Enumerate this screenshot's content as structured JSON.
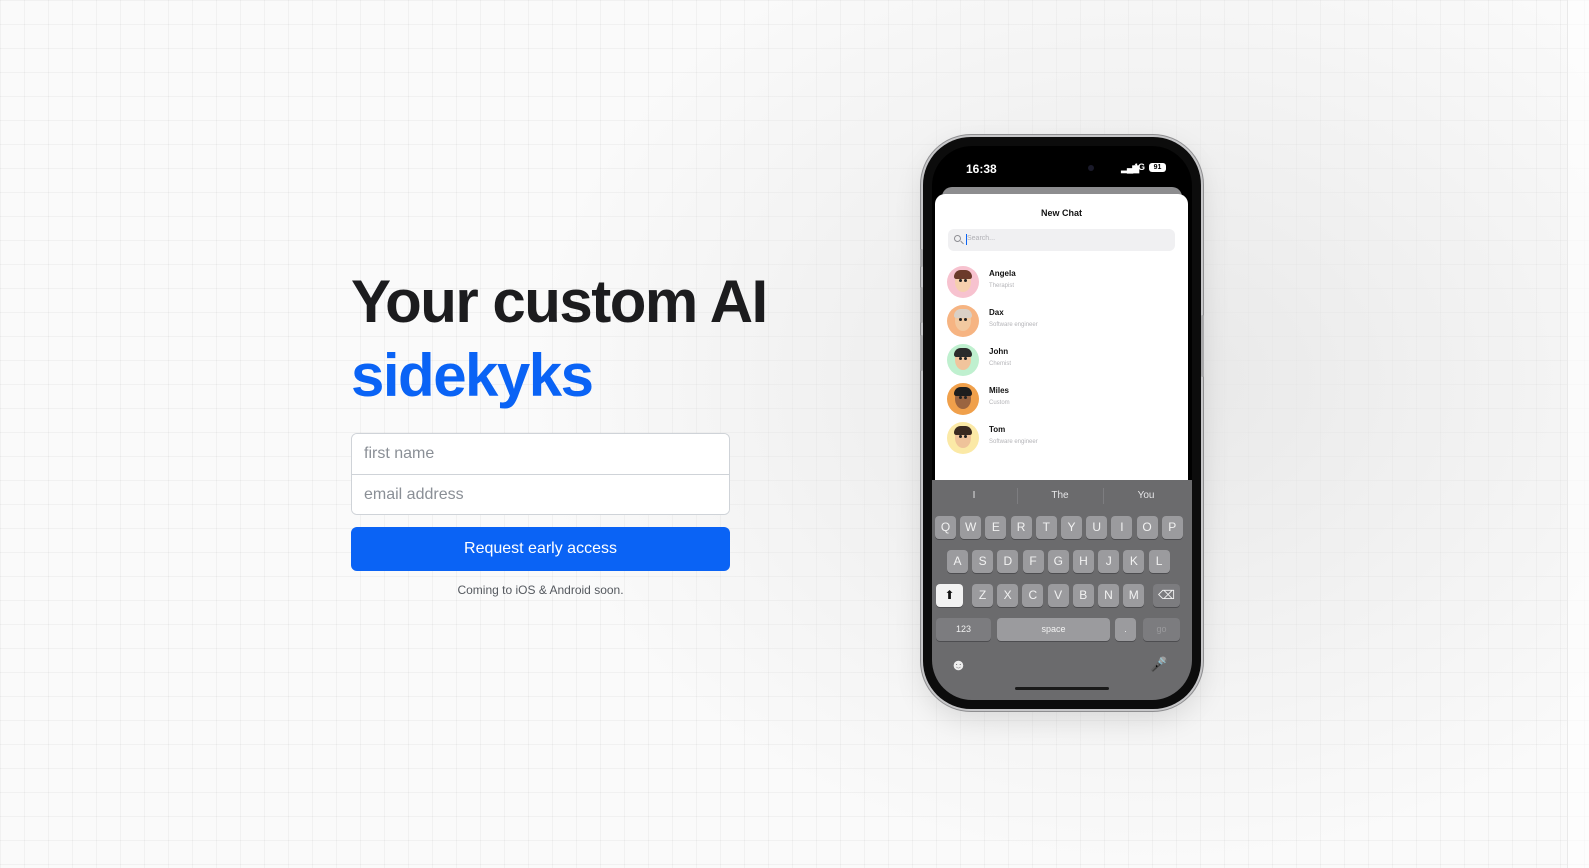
{
  "hero": {
    "headline_line1": "Your custom AI",
    "headline_line2": "sidekyks",
    "accent_color": "#0a63f5"
  },
  "form": {
    "first_name_placeholder": "first name",
    "email_placeholder": "email address",
    "submit_label": "Request early access",
    "note": "Coming to iOS & Android soon."
  },
  "phone": {
    "status": {
      "time": "16:38",
      "network": "4G",
      "battery": "91"
    },
    "sheet_title": "New Chat",
    "search_placeholder": "Search...",
    "contacts": [
      {
        "name": "Angela",
        "role": "Therapist",
        "bg": "#f7c2cf",
        "hair": "#6b3a2a",
        "skin": "#f5cfae"
      },
      {
        "name": "Dax",
        "role": "Software engineer",
        "bg": "#f6b482",
        "hair": "#d9d0c6",
        "skin": "#f2c9a0"
      },
      {
        "name": "John",
        "role": "Chemist",
        "bg": "#bff0cf",
        "hair": "#2b2b2b",
        "skin": "#f1c49c"
      },
      {
        "name": "Miles",
        "role": "Custom",
        "bg": "#f0a04b",
        "hair": "#1e1e1e",
        "skin": "#9a6440"
      },
      {
        "name": "Tom",
        "role": "Software engineer",
        "bg": "#fbe9a6",
        "hair": "#3a2a20",
        "skin": "#efc39a"
      }
    ],
    "keyboard": {
      "suggestions": [
        "I",
        "The",
        "You"
      ],
      "row1": [
        "Q",
        "W",
        "E",
        "R",
        "T",
        "Y",
        "U",
        "I",
        "O",
        "P"
      ],
      "row2": [
        "A",
        "S",
        "D",
        "F",
        "G",
        "H",
        "J",
        "K",
        "L"
      ],
      "row3": [
        "Z",
        "X",
        "C",
        "V",
        "B",
        "N",
        "M"
      ],
      "numbers_key": "123",
      "space_key": "space",
      "period_key": ".",
      "go_key": "go",
      "shift_icon": "⬆",
      "backspace_icon": "⌫",
      "emoji_icon": "☻",
      "mic_icon": "🎤"
    }
  }
}
